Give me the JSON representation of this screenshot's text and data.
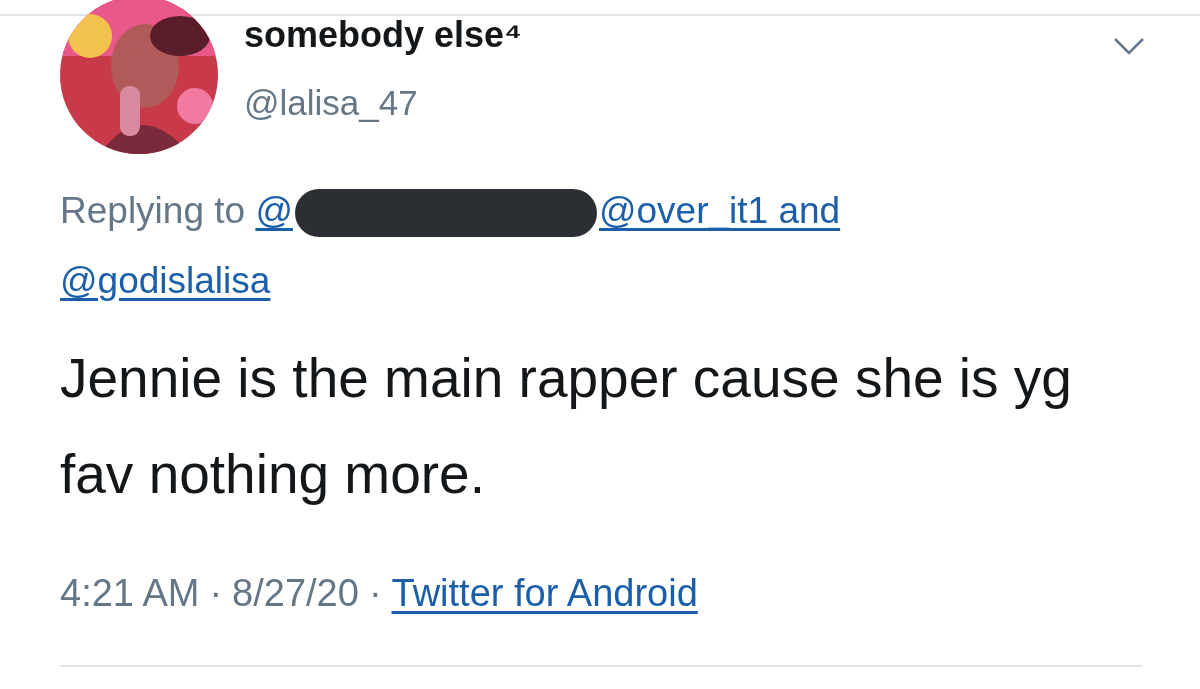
{
  "author": {
    "name": "somebody else⁴",
    "handle": "@lalisa_47"
  },
  "reply_context": {
    "label": "Replying to",
    "mentions": [
      {
        "text": "@",
        "redacted": true
      },
      {
        "text": "@over_it1 and",
        "redacted": false
      },
      {
        "text": "@godislalisa",
        "redacted": false
      }
    ]
  },
  "tweet_text": "Jennie is the main rapper cause she is yg fav nothing more.",
  "meta": {
    "time": "4:21 AM",
    "separator_1": "·",
    "date": "8/27/20",
    "separator_2": "·",
    "source": "Twitter for Android"
  }
}
